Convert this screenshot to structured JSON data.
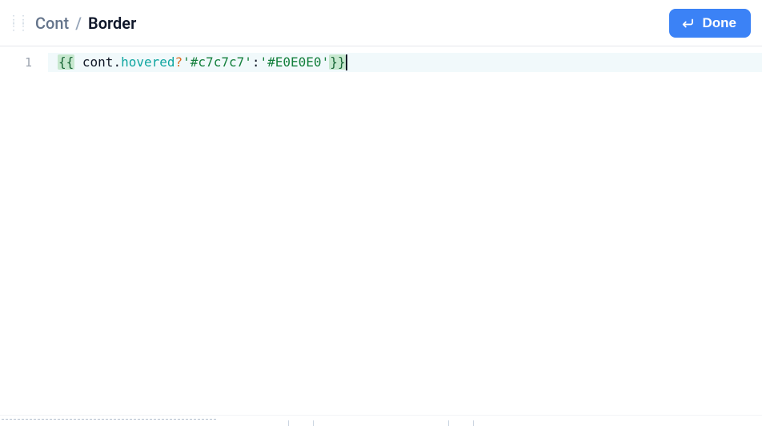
{
  "header": {
    "breadcrumb_parent": "Cont",
    "breadcrumb_separator": "/",
    "breadcrumb_current": "Border",
    "done_label": "Done"
  },
  "editor": {
    "line_number": "1",
    "tokens": {
      "open_braces": "{{",
      "space": " ",
      "ident": "cont",
      "dot": ".",
      "prop": "hovered",
      "qmark": "?",
      "str1": "'#c7c7c7'",
      "colon": ":",
      "str2": "'#E0E0E0'",
      "close_braces": "}}"
    }
  }
}
